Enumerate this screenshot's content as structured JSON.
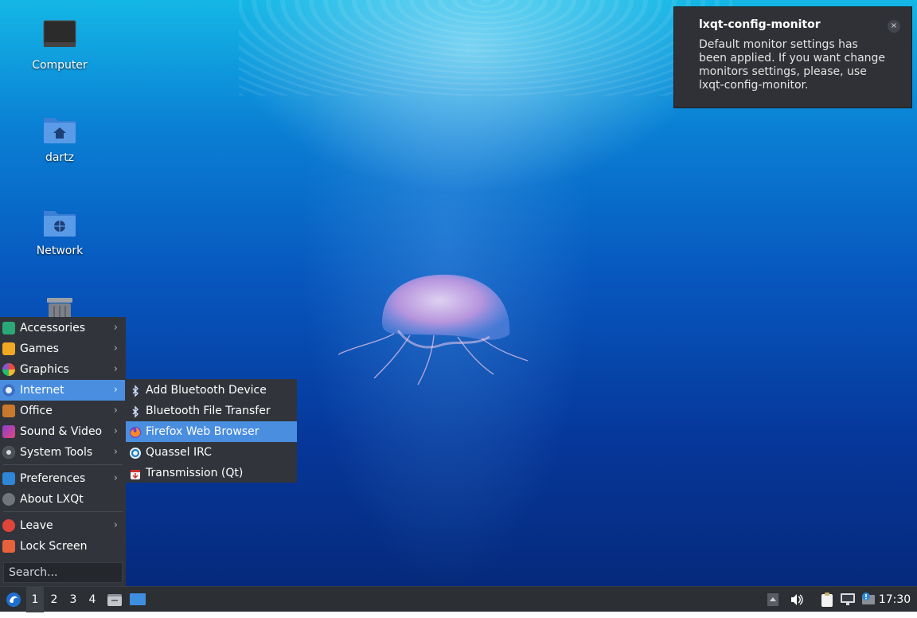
{
  "desktop": {
    "icons": [
      {
        "label": "Computer",
        "icon": "computer-icon"
      },
      {
        "label": "dartz",
        "icon": "home-folder-icon"
      },
      {
        "label": "Network",
        "icon": "network-folder-icon"
      },
      {
        "label": "",
        "icon": "trash-icon"
      }
    ]
  },
  "notification": {
    "title": "lxqt-config-monitor",
    "body_lines": [
      "Default monitor settings has",
      "been applied. If you want change",
      "monitors settings, please, use",
      "lxqt-config-monitor."
    ],
    "close": "×"
  },
  "menu": {
    "items": [
      {
        "label": "Accessories",
        "arrow": "›"
      },
      {
        "label": "Games",
        "arrow": "›"
      },
      {
        "label": "Graphics",
        "arrow": "›"
      },
      {
        "label": "Internet",
        "arrow": "›"
      },
      {
        "label": "Office",
        "arrow": "›"
      },
      {
        "label": "Sound & Video",
        "arrow": "›"
      },
      {
        "label": "System Tools",
        "arrow": "›"
      },
      {
        "label": "Preferences",
        "arrow": "›"
      },
      {
        "label": "About LXQt"
      },
      {
        "label": "Leave",
        "arrow": "›"
      },
      {
        "label": "Lock Screen"
      }
    ],
    "search_placeholder": "Search..."
  },
  "submenu": {
    "items": [
      {
        "label": "Add Bluetooth Device"
      },
      {
        "label": "Bluetooth File Transfer"
      },
      {
        "label": "Firefox Web Browser"
      },
      {
        "label": "Quassel IRC"
      },
      {
        "label": "Transmission (Qt)"
      }
    ]
  },
  "taskbar": {
    "desktops": [
      "1",
      "2",
      "3",
      "4"
    ],
    "current_desktop": "1",
    "clock": "17:30"
  },
  "colors": {
    "menu_bg": "#31353b",
    "highlight": "#4a8ee0",
    "taskbar_bg": "#2c2f33"
  }
}
